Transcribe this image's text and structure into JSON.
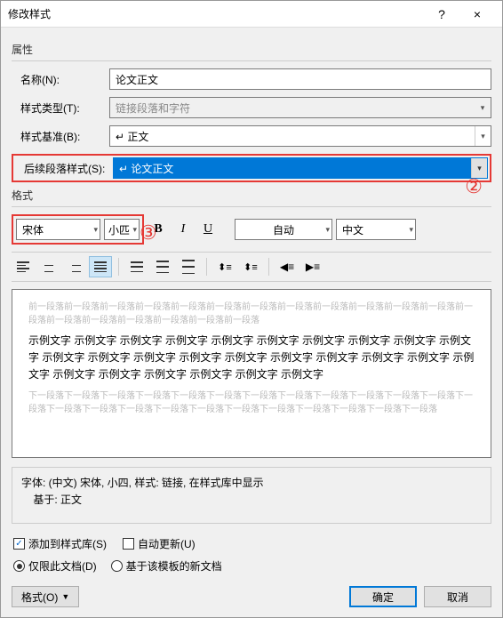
{
  "title": "修改样式",
  "help_btn": "?",
  "close_btn": "×",
  "section_properties": "属性",
  "name_label": "名称(N):",
  "name_value": "论文正文",
  "styletype_label": "样式类型(T):",
  "styletype_value": "链接段落和字符",
  "stylebase_label": "样式基准(B):",
  "stylebase_value": "↵ 正文",
  "following_label": "后续段落样式(S):",
  "following_value": "↵ 论文正文",
  "section_format": "格式",
  "font_value": "宋体",
  "size_value": "小匹",
  "bold": "B",
  "italic": "I",
  "underline": "U",
  "color_value": "自动",
  "lang_value": "中文",
  "preview_gray_before": "前一段落前一段落前一段落前一段落前一段落前一段落前一段落前一段落前一段落前一段落前一段落前一段落前一段落前一段落前一段落前一段落前一段落前一段落前一段落",
  "preview_main": "示例文字 示例文字 示例文字 示例文字 示例文字 示例文字 示例文字 示例文字 示例文字 示例文字 示例文字 示例文字 示例文字 示例文字 示例文字 示例文字 示例文字 示例文字 示例文字 示例文字 示例文字 示例文字 示例文字 示例文字 示例文字 示例文字",
  "preview_gray_after": "下一段落下一段落下一段落下一段落下一段落下一段落下一段落下一段落下一段落下一段落下一段落下一段落下一段落下一段落下一段落下一段落下一段落下一段落下一段落下一段落下一段落下一段落下一段落下一段落",
  "desc_line1": "字体: (中文) 宋体, 小四, 样式: 链接, 在样式库中显示",
  "desc_line2": "    基于: 正文",
  "checkbox_addstyle": "添加到样式库(S)",
  "checkbox_autoupdate": "自动更新(U)",
  "radio_thisdoc": "仅限此文档(D)",
  "radio_template": "基于该模板的新文档",
  "format_btn": "格式(O)",
  "ok_btn": "确定",
  "cancel_btn": "取消",
  "annotation2": "②",
  "annotation3": "③"
}
